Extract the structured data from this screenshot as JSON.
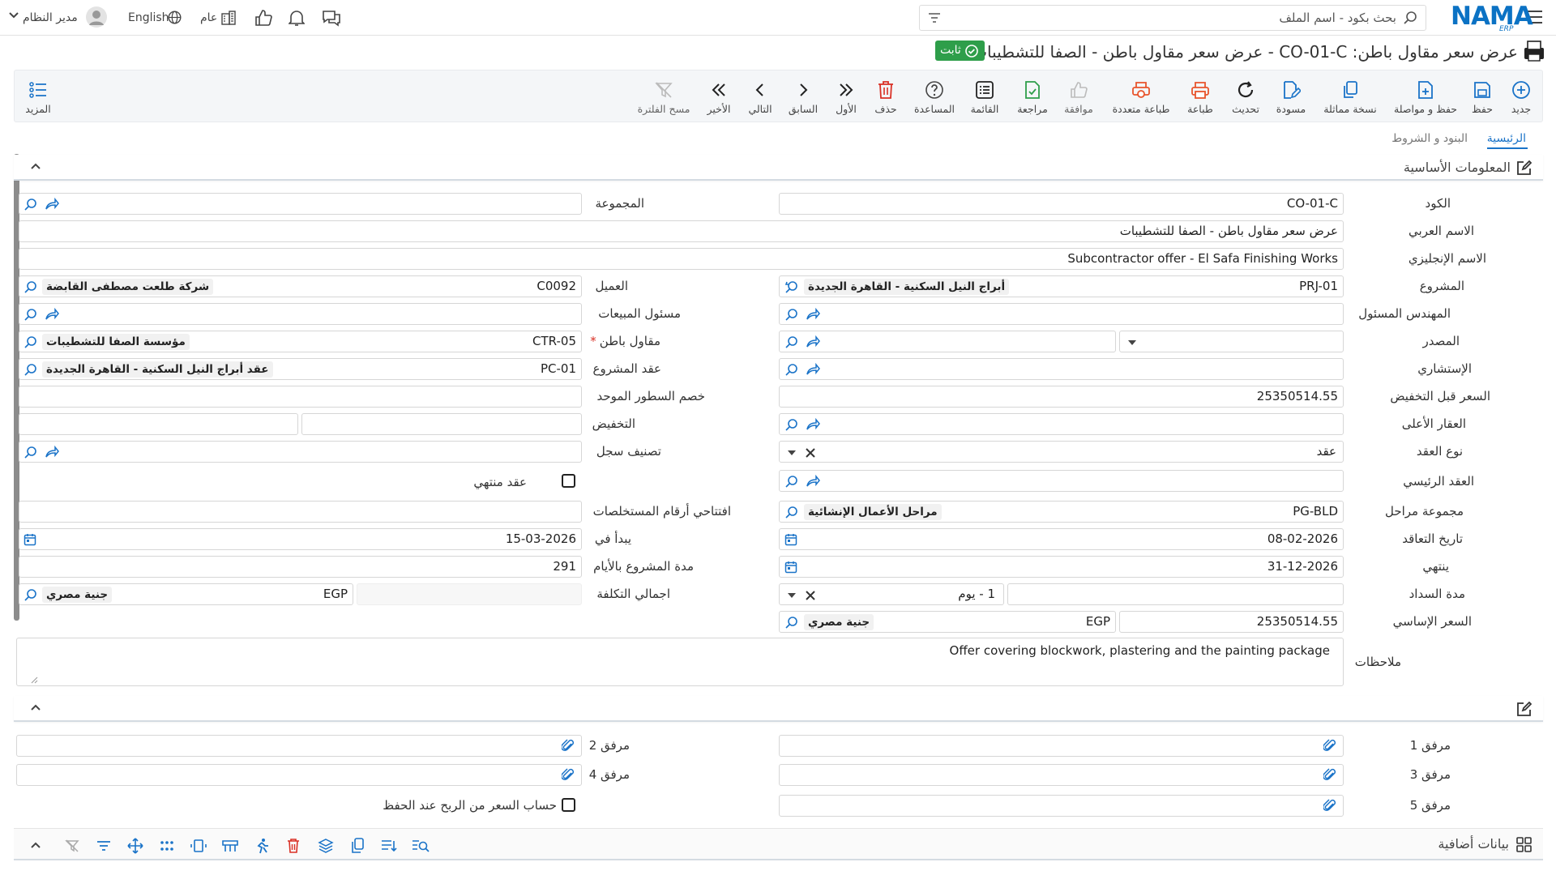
{
  "header": {
    "logo": "NAMA",
    "logo_sub": "ERP",
    "search_placeholder": "بحث بكود - اسم الملف",
    "user_name": "مدير النظام",
    "language": "English",
    "scope": "عام"
  },
  "title": {
    "text": "عرض سعر مقاول باطن: CO-01-C - عرض سعر مقاول باطن - الصفا للتشطيبات",
    "status": "ثابت"
  },
  "toolbar": {
    "new": "جديد",
    "save": "حفظ",
    "save_continue": "حفظ و مواصلة",
    "copy": "نسخة مماثلة",
    "draft": "مسودة",
    "refresh": "تحديث",
    "print": "طباعة",
    "multi_print": "طباعة متعددة",
    "approve": "موافقة",
    "review": "مراجعة",
    "list": "القائمة",
    "help": "المساعدة",
    "delete": "حذف",
    "first": "الأول",
    "previous": "السابق",
    "next": "التالي",
    "last": "الأخير",
    "clear_filter": "مسح الفلترة",
    "more": "المزيد"
  },
  "tabs": {
    "main": "الرئيسية",
    "terms": "البنود و الشروط"
  },
  "sections": {
    "basic_info": "المعلومات الأساسية",
    "additional_data": "بيانات أضافية"
  },
  "labels": {
    "code": "الكود",
    "arabic_name": "الاسم العربي",
    "english_name": "الاسم الإنجليزي",
    "project": "المشروع",
    "engineer": "المهندس المسئول",
    "source": "المصدر",
    "consultant": "الإستشاري",
    "price_before_discount": "السعر قبل التخفيض",
    "parent_property": "العقار الأعلى",
    "contract_type": "نوع العقد",
    "main_contract": "العقد الرئيسي",
    "phase_group": "مجموعة مراحل",
    "contract_date": "تاريخ التعاقد",
    "end_date": "ينتهي",
    "payment_period": "مدة السداد",
    "base_price": "السعر الإساسي",
    "notes": "ملاحظات",
    "group": "المجموعة",
    "customer": "العميل",
    "sales_rep": "مسئول المبيعات",
    "subcontractor": "مقاول باطن",
    "project_contract": "عقد المشروع",
    "unified_line_discount": "خصم السطور الموحد",
    "discount": "التخفيض",
    "record_class": "تصنيف سجل",
    "contract_ended": "عقد منتهي",
    "opening_numbers": "افتتاحي أرقام المستخلصات",
    "starts_on": "يبدأ في",
    "duration_days": "مدة المشروع بالأيام",
    "total_cost": "اجمالي التكلفة",
    "attachment1": "مرفق 1",
    "attachment2": "مرفق 2",
    "attachment3": "مرفق 3",
    "attachment4": "مرفق 4",
    "attachment5": "مرفق 5",
    "calc_price": "حساب السعر من الربح عند الحفظ"
  },
  "values": {
    "code": "CO-01-C",
    "arabic_name": "عرض سعر مقاول باطن - الصفا للتشطيبات",
    "english_name": "Subcontractor offer - El Safa Finishing Works",
    "project_code": "PRJ-01",
    "project_name": "أبراج النيل السكنية - القاهرة الجديدة",
    "price_before_discount": "25350514.55",
    "contract_type": "عقد",
    "phase_group_code": "PG-BLD",
    "phase_group_name": "مراحل الأعمال الإنشائية",
    "contract_date": "08-02-2026",
    "end_date": "31-12-2026",
    "payment_period_unit": "1 - يوم",
    "base_price": "25350514.55",
    "base_currency_code": "EGP",
    "base_currency_name": "جنية مصري",
    "notes": "Offer covering blockwork, plastering and the painting package",
    "customer_code": "C0092",
    "customer_name": "شركة طلعت مصطفى القابضة",
    "subcontractor_code": "CTR-05",
    "subcontractor_name": "مؤسسة الصفا للتشطيبات",
    "project_contract_code": "PC-01",
    "project_contract_name": "عقد أبراج النيل السكنية - القاهرة الجديدة",
    "starts_on": "15-03-2026",
    "duration_days": "291",
    "total_cost_currency_code": "EGP",
    "total_cost_currency_name": "جنية مصري"
  },
  "colors": {
    "brand": "#0b72c4",
    "icon_blue": "#1a73c8",
    "status_green": "#2e9e4a",
    "delete_red": "#d93025",
    "print_orange": "#e8542c",
    "review_green": "#2e9e4a"
  }
}
